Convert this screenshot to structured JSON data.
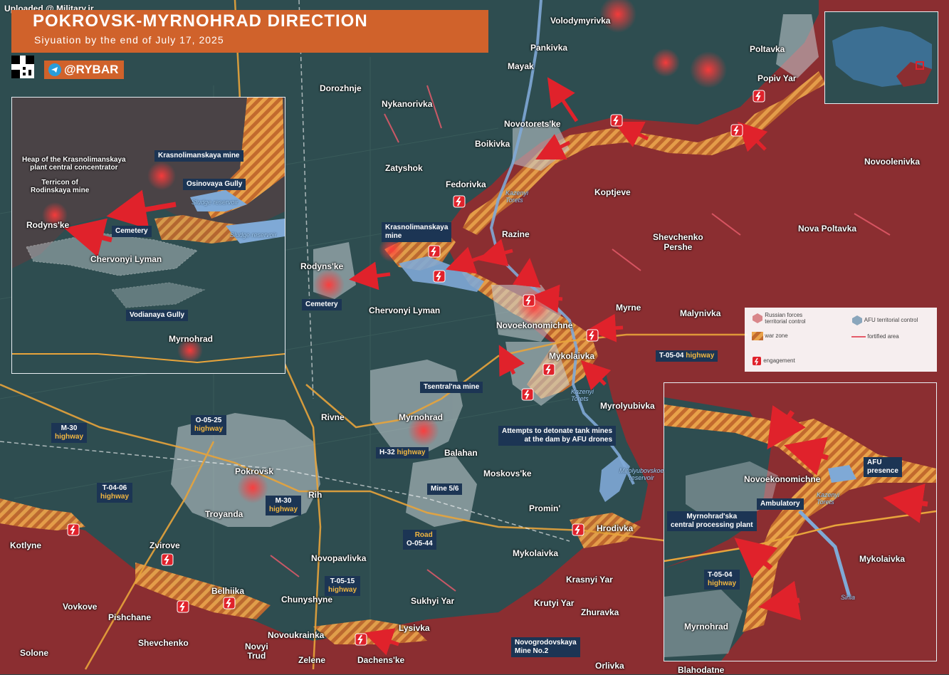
{
  "header": {
    "title": "POKROVSK-MYRNOHRAD DIRECTION",
    "subtitle": "Siyuation by the end of July 17, 2025"
  },
  "watermark": "Uploaded @ Military.ir",
  "brand": {
    "handle": "@RYBAR",
    "icon": "telegram-icon"
  },
  "colors": {
    "russian_control": "#8b2e31",
    "afu_control": "#2f4f55",
    "war_zone": "#e39a3a",
    "engagement": "#e0222b",
    "header": "#d0622b",
    "tag": "#1c3554"
  },
  "settlements": {
    "volodymyrivka": "Volodymyrivka",
    "pankivka": "Pankivka",
    "poltavka": "Poltavka",
    "mayak": "Mayak",
    "popiv_yar": "Popiv Yar",
    "dorozhnje": "Dorozhnje",
    "nykanorivka": "Nykanorivka",
    "novotoretske": "Novotorets'ke",
    "boikivka": "Boikivka",
    "novoolenivka": "Novoolenivka",
    "zatyshok": "Zatyshok",
    "fedorivka": "Fedorivka",
    "koptjeve": "Koptjeve",
    "razine": "Razine",
    "shevchenko_pershe": "Shevchenko\nPershe",
    "nova_poltavka": "Nova Poltavka",
    "rodynske": "Rodyns'ke",
    "chervonyi_lyman": "Chervonyi Lyman",
    "myrne": "Myrne",
    "malynivka": "Malynivka",
    "novoekonomichne": "Novoekonomichne",
    "mykolaivka": "Mykolaivka",
    "myrolyubivka": "Myrolyubivka",
    "myrnohrad": "Myrnohrad",
    "rivne": "Rivne",
    "balahan": "Balahan",
    "moskovske": "Moskovs'ke",
    "pokrovsk": "Pokrovsk",
    "rih": "Rih",
    "troyanda": "Troyanda",
    "promin": "Promin'",
    "hrodivka": "Hrodivka",
    "mykolaivka_s": "Mykolaivka",
    "kotlyne": "Kotlyne",
    "zvirove": "Zvirove",
    "novopavlivka": "Novopavlivka",
    "krasnyi_yar": "Krasnyi Yar",
    "belhiika": "Belhiika",
    "chunyshyne": "Chunyshyne",
    "sukhyi_yar": "Sukhyi Yar",
    "krutyi_yar": "Krutyi Yar",
    "zhuravka": "Zhuravka",
    "vovkove": "Vovkove",
    "pishchane": "Pishchane",
    "novoukrainka": "Novoukrainka",
    "lysivka": "Lysivka",
    "shevchenko": "Shevchenko",
    "novyi_trud": "Novyi\nTrud",
    "solone": "Solone",
    "zelene": "Zelene",
    "dachenske": "Dachens'ke",
    "orlivka": "Orlivka",
    "blahodatne": "Blahodatne"
  },
  "features": {
    "krasnolimanskaya_mine": "Krasnolimanskaya\nmine",
    "cemetery": "Cemetery",
    "kazenyi_torets": "Kazenyi\nTorets",
    "tsentralna_mine": "Tsentral'na mine",
    "mine_56": "Mine 5/6",
    "novogrodovskaya": "Novogrodovskaya\nMine No.2",
    "dam_note": "Attempts to detonate tank mines\nat the dam by AFU drones",
    "reservoir": "Mirolyubovskoe\nreservoir"
  },
  "roads": {
    "m30_a": "M-30",
    "o0525": "O-05-25",
    "t0406": "T-04-06",
    "m30_b": "M-30",
    "h32": "H-32",
    "road_o0544_a": "Road",
    "road_o0544_b": "O-05-44",
    "t0515": "T-05-15",
    "t0504": "T-05-04",
    "hw": "highway"
  },
  "inset_left": {
    "krasnolimanskaya_mine": "Krasnolimanskaya mine",
    "heap": "Heap of the Krasnolimanskaya\nplant central concentrator",
    "terricon": "Terricon of\nRodinskaya mine",
    "osinovaya": "Osinovaya Gully",
    "sludge1": "Sludge reservoir",
    "sludge2": "Sludge reservoir",
    "rodynske": "Rodyns'ke",
    "cemetery": "Cemetery",
    "chervonyi_lyman": "Chervonyi Lyman",
    "vodianaya": "Vodianaya Gully",
    "myrnohrad": "Myrnohrad"
  },
  "inset_right": {
    "afu_presence": "AFU\npresence",
    "novoekonomichne": "Novoekonomichne",
    "ambulatory": "Ambulatory",
    "kazenyi_torets": "Kazenyi\nTorets",
    "processing_plant": "Myrnohrad'ska\ncentral processing plant",
    "mykolaivka": "Mykolaivka",
    "t0504": "T-05-04",
    "hw": "highway",
    "myrnohrad": "Myrnohrad",
    "sinia": "Sinia"
  },
  "legend": {
    "russian": "Russian forces\nterritorial control",
    "afu": "AFU territorial control",
    "war_zone": "war zone",
    "fortified": "fortified area",
    "engagement": "engagement"
  }
}
